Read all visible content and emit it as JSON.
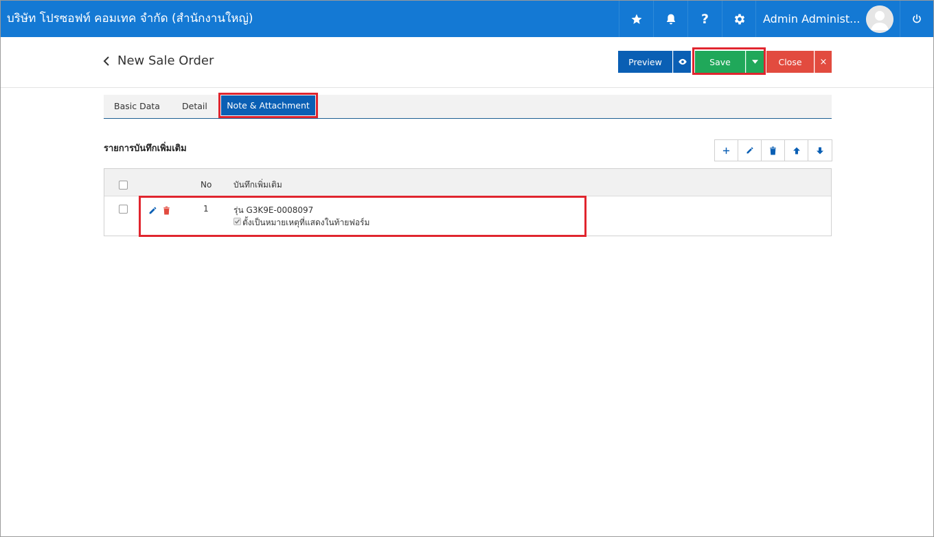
{
  "topbar": {
    "company": "บริษัท โปรซอฟท์ คอมเทค จำกัด (สำนักงานใหญ่)",
    "user_name": "Admin Administ...",
    "icons": [
      "star-icon",
      "bell-icon",
      "question-icon",
      "gear-icon",
      "power-icon"
    ]
  },
  "header": {
    "title": "New Sale Order",
    "preview_label": "Preview",
    "save_label": "Save",
    "close_label": "Close"
  },
  "tabs": [
    {
      "label": "Basic Data"
    },
    {
      "label": "Detail"
    },
    {
      "label": "Note & Attachment",
      "active": true
    }
  ],
  "section": {
    "title": "รายการบันทึกเพิ่มเติม",
    "toolbar": [
      "plus-icon",
      "pencil-icon",
      "trash-icon",
      "arrow-up-icon",
      "arrow-down-icon"
    ]
  },
  "table": {
    "columns": [
      "No",
      "บันทึกเพิ่มเติม"
    ],
    "rows": [
      {
        "no": "1",
        "note": "รุ่น G3K9E-0008097",
        "option_label": "ตั้งเป็นหมายเหตุที่แสดงในท้ายฟอร์ม",
        "option_checked": true
      }
    ]
  },
  "colors": {
    "topbar": "#1479d4",
    "primary": "#0a5fb4",
    "save": "#20a85a",
    "close": "#e24b3f",
    "highlight": "#e0252e"
  }
}
